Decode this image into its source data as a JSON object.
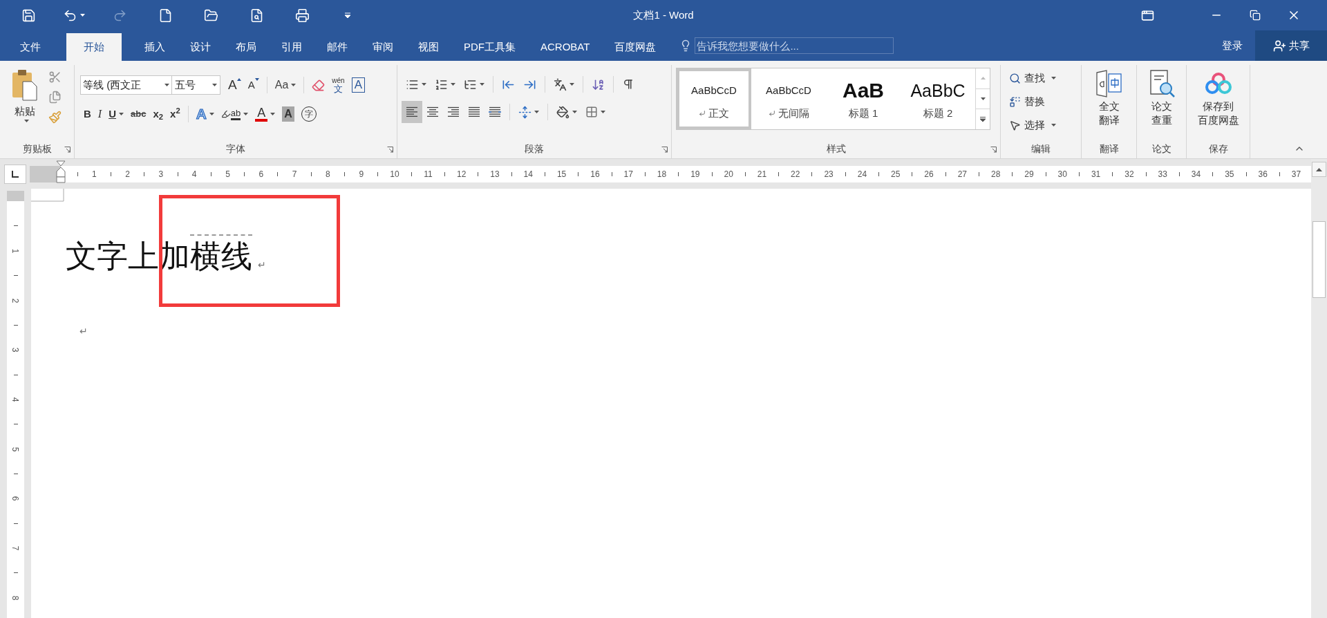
{
  "window": {
    "title": "文档1 - Word"
  },
  "quick_access": [
    {
      "kind": "save",
      "disabled": false,
      "dropdown": false
    },
    {
      "kind": "undo",
      "disabled": false,
      "dropdown": true
    },
    {
      "kind": "redo",
      "disabled": true,
      "dropdown": false
    },
    {
      "kind": "new",
      "disabled": false,
      "dropdown": false
    },
    {
      "kind": "open",
      "disabled": false,
      "dropdown": false
    },
    {
      "kind": "preview",
      "disabled": false,
      "dropdown": false
    },
    {
      "kind": "print",
      "disabled": false,
      "dropdown": false
    },
    {
      "kind": "customize",
      "disabled": false,
      "dropdown": false
    }
  ],
  "tabs": [
    {
      "label": "文件",
      "selected": false
    },
    {
      "label": "开始",
      "selected": true
    },
    {
      "label": "插入",
      "selected": false
    },
    {
      "label": "设计",
      "selected": false
    },
    {
      "label": "布局",
      "selected": false
    },
    {
      "label": "引用",
      "selected": false
    },
    {
      "label": "邮件",
      "selected": false
    },
    {
      "label": "审阅",
      "selected": false
    },
    {
      "label": "视图",
      "selected": false
    },
    {
      "label": "PDF工具集",
      "selected": false
    },
    {
      "label": "ACROBAT",
      "selected": false
    },
    {
      "label": "百度网盘",
      "selected": false
    }
  ],
  "tell_me": {
    "placeholder": "告诉我您想要做什么..."
  },
  "account": {
    "sign_in": "登录",
    "share": "共享"
  },
  "ribbon": {
    "clipboard": {
      "paste": "粘贴",
      "label": "剪贴板"
    },
    "font": {
      "font_name": "等线 (西文正",
      "font_size": "五号",
      "label": "字体",
      "row1": [
        {
          "kind": "grow",
          "glyph": "A",
          "dropdown": false
        },
        {
          "kind": "shrink",
          "glyph": "A",
          "dropdown": false
        },
        {
          "kind": "separator"
        },
        {
          "kind": "case",
          "glyph": "Aa",
          "dropdown": true
        },
        {
          "kind": "separator"
        },
        {
          "kind": "clear",
          "dropdown": false
        },
        {
          "kind": "phonetic",
          "glyph": "wén",
          "glyph2": "文",
          "dropdown": false
        },
        {
          "kind": "border",
          "glyph": "A",
          "dropdown": false
        }
      ],
      "row2": [
        {
          "kind": "bold",
          "glyph": "B",
          "dropdown": false
        },
        {
          "kind": "italic",
          "glyph": "I",
          "dropdown": false
        },
        {
          "kind": "underline",
          "glyph": "U",
          "dropdown": true
        },
        {
          "kind": "strike",
          "glyph": "abc",
          "dropdown": false
        },
        {
          "kind": "sub",
          "glyph": "x$_{2}$",
          "dropdown": false
        },
        {
          "kind": "sup",
          "glyph": "x$^{2}$",
          "dropdown": false
        },
        {
          "kind": "separator"
        },
        {
          "kind": "effect",
          "glyph": "A",
          "dropdown": true
        },
        {
          "kind": "highlight",
          "glyph": "ab",
          "dropdown": true
        },
        {
          "kind": "color",
          "glyph": "A",
          "dropdown": true
        },
        {
          "kind": "shading",
          "glyph": "A",
          "dropdown": false
        },
        {
          "kind": "enclose",
          "glyph": "字",
          "dropdown": false
        }
      ]
    },
    "paragraph": {
      "label": "段落",
      "row1": [
        {
          "kind": "bullets",
          "dropdown": true
        },
        {
          "kind": "numbering",
          "dropdown": true
        },
        {
          "kind": "multilevel",
          "dropdown": true
        },
        {
          "kind": "separator"
        },
        {
          "kind": "outdent",
          "dropdown": false
        },
        {
          "kind": "indent",
          "dropdown": false
        },
        {
          "kind": "separator"
        },
        {
          "kind": "layout",
          "dropdown": true
        },
        {
          "kind": "separator"
        },
        {
          "kind": "sort",
          "dropdown": false
        },
        {
          "kind": "separator"
        },
        {
          "kind": "marks",
          "dropdown": false
        }
      ],
      "row2": [
        {
          "kind": "left",
          "dropdown": false,
          "selected": true
        },
        {
          "kind": "center",
          "dropdown": false,
          "selected": false
        },
        {
          "kind": "right",
          "dropdown": false,
          "selected": false
        },
        {
          "kind": "justify",
          "dropdown": false,
          "selected": false
        },
        {
          "kind": "distributed",
          "dropdown": false,
          "selected": false
        },
        {
          "kind": "separator"
        },
        {
          "kind": "spacing",
          "dropdown": true,
          "selected": false
        },
        {
          "kind": "separator"
        },
        {
          "kind": "shade",
          "dropdown": true,
          "selected": false
        },
        {
          "kind": "borders",
          "dropdown": true,
          "selected": false
        }
      ]
    },
    "styles": {
      "label": "样式",
      "items": [
        {
          "kind": "body",
          "preview": "AaBbCcD",
          "label": "正文",
          "mark": true,
          "selected": true
        },
        {
          "kind": "body",
          "preview": "AaBbCcD",
          "label": "无间隔",
          "mark": true,
          "selected": false
        },
        {
          "kind": "heading1",
          "preview": "AaB",
          "label": "标题 1",
          "mark": false,
          "selected": false
        },
        {
          "kind": "heading2",
          "preview": "AaBbC",
          "label": "标题 2",
          "mark": false,
          "selected": false
        }
      ]
    },
    "editing": {
      "label": "编辑",
      "items": [
        {
          "kind": "find",
          "label": "查找",
          "dropdown": true
        },
        {
          "kind": "replace",
          "label": "替换",
          "dropdown": false
        },
        {
          "kind": "select",
          "label": "选择",
          "dropdown": true
        }
      ]
    },
    "big_groups": [
      {
        "kind": "translate",
        "lines": [
          "全文",
          "翻译"
        ],
        "label": "翻译"
      },
      {
        "kind": "check",
        "lines": [
          "论文",
          "查重"
        ],
        "label": "论文"
      },
      {
        "kind": "cloud",
        "lines": [
          "保存到",
          "百度网盘"
        ],
        "label": "保存"
      }
    ]
  },
  "ruler": {
    "numbers": [
      "1",
      "2",
      "3",
      "4",
      "5",
      "6",
      "7",
      "8",
      "9",
      "10",
      "11",
      "12",
      "13",
      "14",
      "15",
      "16",
      "17",
      "18",
      "19",
      "20",
      "21",
      "22",
      "23",
      "24",
      "25",
      "26",
      "27",
      "28",
      "29",
      "30",
      "31",
      "32",
      "33",
      "34",
      "35",
      "36",
      "37"
    ]
  },
  "vertical_ruler": {
    "numbers": [
      "1",
      "2",
      "3",
      "4",
      "5",
      "6",
      "7",
      "8"
    ]
  },
  "document": {
    "paragraphs": [
      {
        "segments": [
          {
            "text": "文字上加",
            "overline": false
          },
          {
            "text": "横线",
            "overline": true
          }
        ],
        "mark": "↵"
      },
      {
        "mark": "↵"
      }
    ]
  }
}
